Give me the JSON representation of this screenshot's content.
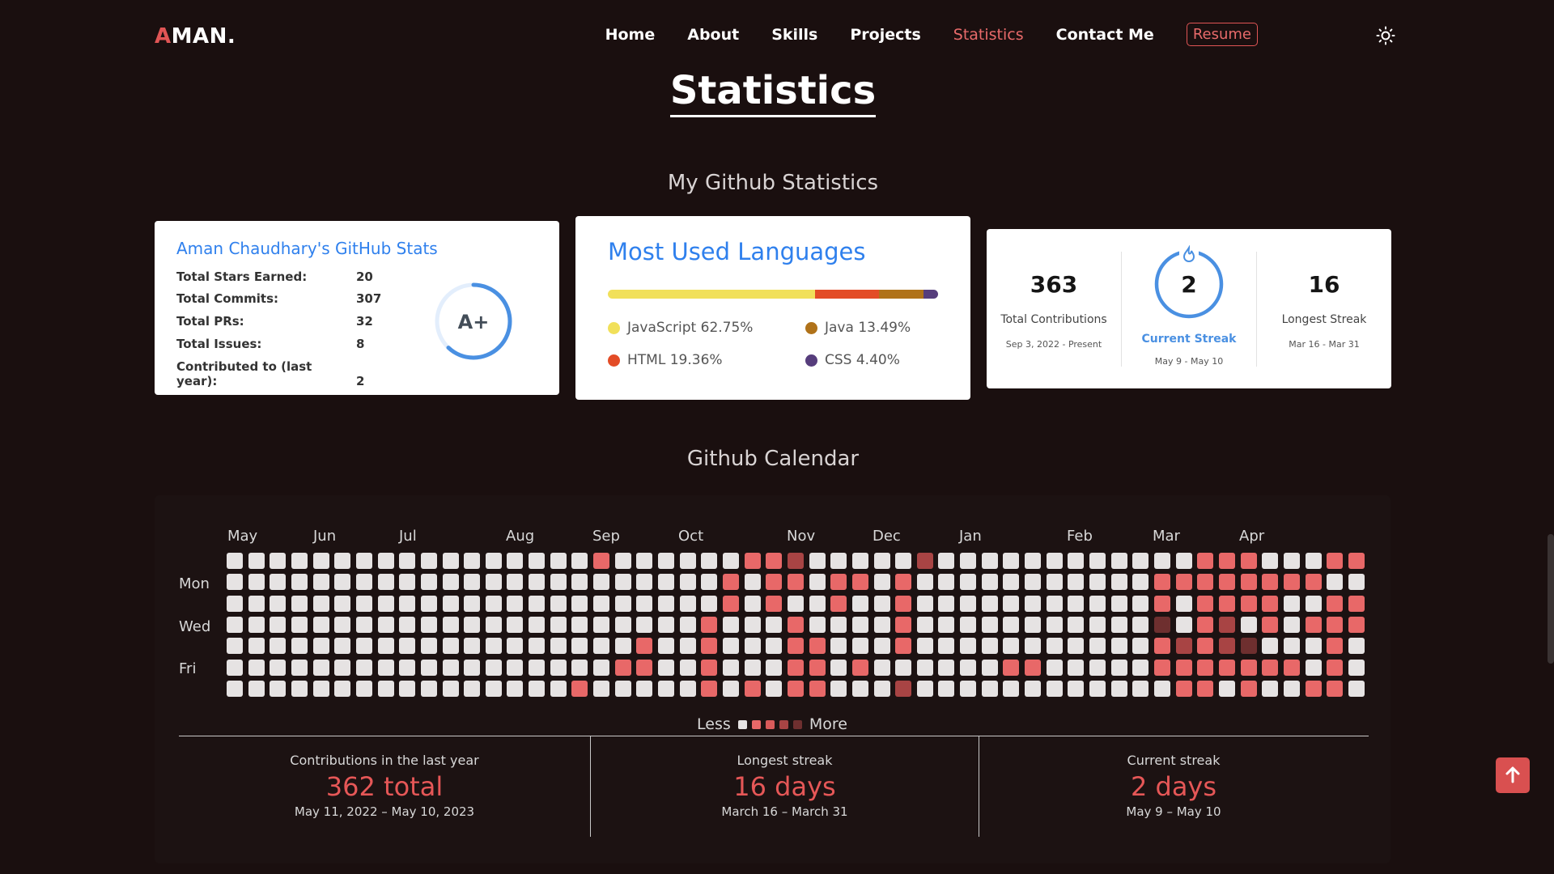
{
  "logo": {
    "first": "A",
    "rest": "MAN."
  },
  "nav": {
    "items": [
      "Home",
      "About",
      "Skills",
      "Projects",
      "Statistics",
      "Contact Me"
    ],
    "active": "Statistics",
    "resume": "Resume"
  },
  "page_title": "Statistics",
  "github_section_title": "My Github Statistics",
  "stats_card": {
    "title": "Aman Chaudhary's GitHub Stats",
    "rows": [
      {
        "label": "Total Stars Earned:",
        "value": "20"
      },
      {
        "label": "Total Commits:",
        "value": "307"
      },
      {
        "label": "Total PRs:",
        "value": "32"
      },
      {
        "label": "Total Issues:",
        "value": "8"
      },
      {
        "label": "Contributed to (last year):",
        "value": "2"
      }
    ],
    "grade": "A+",
    "grade_progress": 0.62
  },
  "languages_card": {
    "title": "Most Used Languages",
    "languages": [
      {
        "name": "JavaScript",
        "pct": "62.75%",
        "value": 62.75,
        "color": "#f1e05a"
      },
      {
        "name": "HTML",
        "pct": "19.36%",
        "value": 19.36,
        "color": "#e34c26"
      },
      {
        "name": "Java",
        "pct": "13.49%",
        "value": 13.49,
        "color": "#b07219"
      },
      {
        "name": "CSS",
        "pct": "4.40%",
        "value": 4.4,
        "color": "#563d7c"
      }
    ]
  },
  "streak_card": {
    "total": {
      "value": "363",
      "label": "Total Contributions",
      "range": "Sep 3, 2022 - Present"
    },
    "current": {
      "value": "2",
      "label": "Current Streak",
      "range": "May 9 - May 10"
    },
    "longest": {
      "value": "16",
      "label": "Longest Streak",
      "range": "Mar 16 - Mar 31"
    }
  },
  "calendar_section_title": "Github Calendar",
  "calendar": {
    "months": [
      "May",
      "Jun",
      "Jul",
      "Aug",
      "Sep",
      "Oct",
      "Nov",
      "Dec",
      "Jan",
      "Feb",
      "Mar",
      "Apr"
    ],
    "day_labels": [
      "Mon",
      "Wed",
      "Fri"
    ],
    "legend_less": "Less",
    "legend_more": "More",
    "level_colors": [
      "#e6e3e3",
      "#e86868",
      "#d95a5a",
      "#a84444",
      "#6e2f2f"
    ],
    "active_cells": [
      [
        17,
        0,
        1
      ],
      [
        24,
        0,
        1
      ],
      [
        25,
        0,
        1
      ],
      [
        26,
        0,
        3
      ],
      [
        32,
        0,
        3
      ],
      [
        45,
        0,
        1
      ],
      [
        46,
        0,
        1
      ],
      [
        47,
        0,
        1
      ],
      [
        51,
        0,
        1
      ],
      [
        52,
        0,
        1
      ],
      [
        23,
        1,
        1
      ],
      [
        25,
        1,
        1
      ],
      [
        26,
        1,
        1
      ],
      [
        28,
        1,
        1
      ],
      [
        29,
        1,
        1
      ],
      [
        31,
        1,
        1
      ],
      [
        43,
        1,
        1
      ],
      [
        44,
        1,
        1
      ],
      [
        45,
        1,
        1
      ],
      [
        46,
        1,
        1
      ],
      [
        47,
        1,
        1
      ],
      [
        48,
        1,
        1
      ],
      [
        49,
        1,
        1
      ],
      [
        50,
        1,
        1
      ],
      [
        23,
        2,
        1
      ],
      [
        25,
        2,
        1
      ],
      [
        28,
        2,
        1
      ],
      [
        31,
        2,
        1
      ],
      [
        43,
        2,
        1
      ],
      [
        45,
        2,
        1
      ],
      [
        46,
        2,
        1
      ],
      [
        47,
        2,
        1
      ],
      [
        48,
        2,
        1
      ],
      [
        51,
        2,
        1
      ],
      [
        52,
        2,
        1
      ],
      [
        22,
        3,
        1
      ],
      [
        26,
        3,
        1
      ],
      [
        31,
        3,
        1
      ],
      [
        43,
        3,
        4
      ],
      [
        45,
        3,
        1
      ],
      [
        46,
        3,
        3
      ],
      [
        48,
        3,
        1
      ],
      [
        50,
        3,
        1
      ],
      [
        51,
        3,
        1
      ],
      [
        52,
        3,
        1
      ],
      [
        19,
        4,
        1
      ],
      [
        22,
        4,
        1
      ],
      [
        26,
        4,
        1
      ],
      [
        27,
        4,
        1
      ],
      [
        31,
        4,
        1
      ],
      [
        43,
        4,
        1
      ],
      [
        44,
        4,
        3
      ],
      [
        45,
        4,
        1
      ],
      [
        46,
        4,
        3
      ],
      [
        47,
        4,
        4
      ],
      [
        51,
        4,
        1
      ],
      [
        18,
        5,
        1
      ],
      [
        19,
        5,
        1
      ],
      [
        22,
        5,
        1
      ],
      [
        26,
        5,
        1
      ],
      [
        27,
        5,
        1
      ],
      [
        29,
        5,
        1
      ],
      [
        36,
        5,
        1
      ],
      [
        37,
        5,
        1
      ],
      [
        43,
        5,
        1
      ],
      [
        44,
        5,
        1
      ],
      [
        45,
        5,
        1
      ],
      [
        46,
        5,
        1
      ],
      [
        47,
        5,
        1
      ],
      [
        48,
        5,
        1
      ],
      [
        49,
        5,
        1
      ],
      [
        51,
        5,
        1
      ],
      [
        16,
        6,
        1
      ],
      [
        22,
        6,
        1
      ],
      [
        24,
        6,
        1
      ],
      [
        26,
        6,
        1
      ],
      [
        27,
        6,
        1
      ],
      [
        31,
        6,
        3
      ],
      [
        44,
        6,
        1
      ],
      [
        45,
        6,
        1
      ],
      [
        47,
        6,
        1
      ],
      [
        50,
        6,
        1
      ],
      [
        51,
        6,
        1
      ]
    ],
    "stats": [
      {
        "title": "Contributions in the last year",
        "big": "362 total",
        "dates": "May 11, 2022 – May 10, 2023"
      },
      {
        "title": "Longest streak",
        "big": "16 days",
        "dates": "March 16 – March 31"
      },
      {
        "title": "Current streak",
        "big": "2 days",
        "dates": "May 9 – May 10"
      }
    ]
  }
}
